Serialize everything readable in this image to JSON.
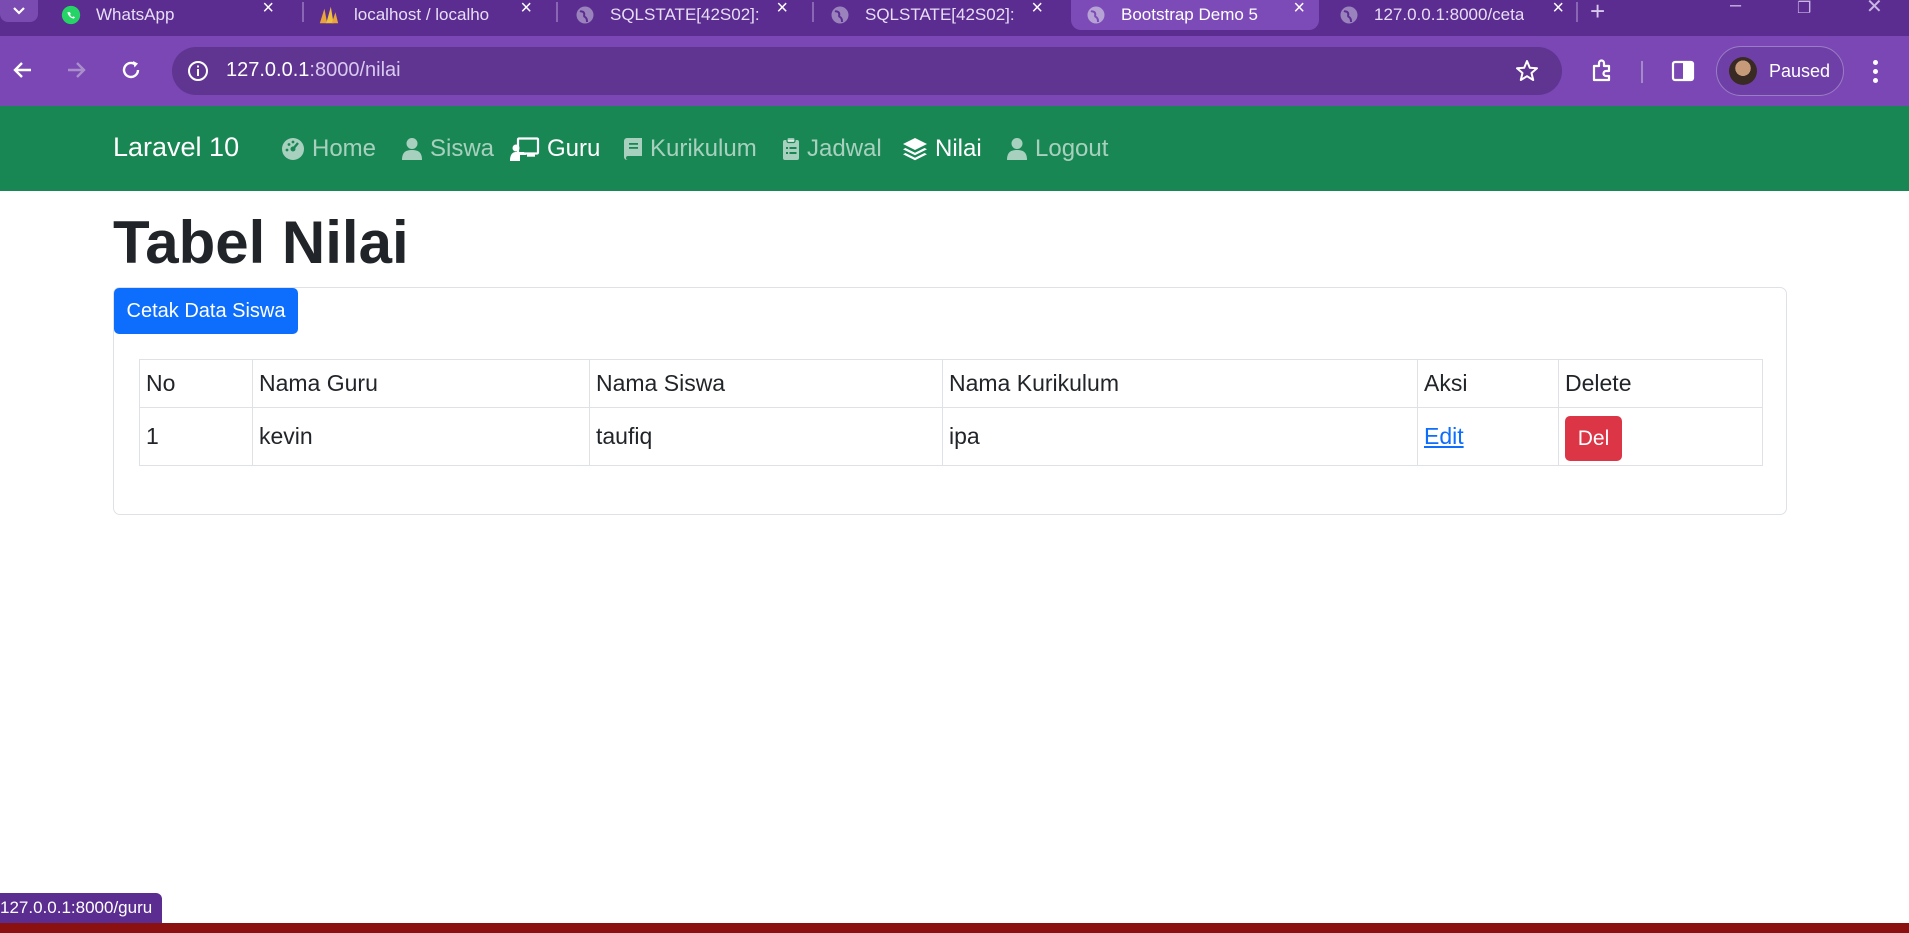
{
  "browser": {
    "tabs": [
      {
        "title": "WhatsApp",
        "favicon": "whatsapp-icon",
        "active": false
      },
      {
        "title": "localhost / localho",
        "favicon": "phpmyadmin-icon",
        "active": false
      },
      {
        "title": "SQLSTATE[42S02]: ",
        "favicon": "globe-icon",
        "active": false
      },
      {
        "title": "SQLSTATE[42S02]: ",
        "favicon": "globe-icon",
        "active": false
      },
      {
        "title": "Bootstrap Demo 5",
        "favicon": "globe-icon",
        "active": true
      },
      {
        "title": "127.0.0.1:8000/ceta",
        "favicon": "globe-icon",
        "active": false
      }
    ],
    "url_host": "127.0.0.1",
    "url_rest": ":8000/nilai",
    "profile_status": "Paused",
    "status_url": "127.0.0.1:8000/guru",
    "colors": {
      "frame": "#5b2d90",
      "toolbar": "#7a47b4",
      "omnibox": "#5f3591"
    }
  },
  "navbar": {
    "brand": "Laravel 10",
    "items": [
      {
        "label": "Home",
        "icon": "dashboard-icon",
        "active": false
      },
      {
        "label": "Siswa",
        "icon": "user-icon",
        "active": false
      },
      {
        "label": "Guru",
        "icon": "chalkboard-teacher-icon",
        "active": true
      },
      {
        "label": "Kurikulum",
        "icon": "book-icon",
        "active": false
      },
      {
        "label": "Jadwal",
        "icon": "clipboard-icon",
        "active": false
      },
      {
        "label": "Nilai",
        "icon": "layers-icon",
        "active": true
      },
      {
        "label": "Logout",
        "icon": "user-icon",
        "active": false
      }
    ],
    "color": "#198754"
  },
  "main": {
    "title": "Tabel Nilai",
    "print_button": "Cetak Data Siswa",
    "table": {
      "headers": [
        "No",
        "Nama Guru",
        "Nama Siswa",
        "Nama Kurikulum",
        "Aksi",
        "Delete"
      ],
      "rows": [
        {
          "no": "1",
          "guru": "kevin",
          "siswa": "taufiq",
          "kurikulum": "ipa",
          "edit": "Edit",
          "delete": "Del"
        }
      ]
    }
  }
}
